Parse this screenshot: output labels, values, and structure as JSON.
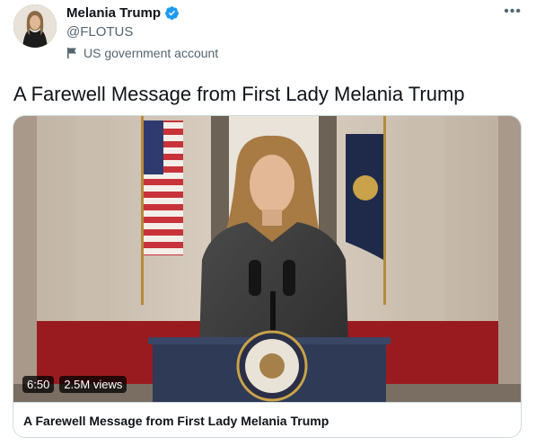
{
  "author": {
    "display_name": "Melania Trump",
    "handle": "@FLOTUS",
    "label": "US government account",
    "verified": true
  },
  "tweet": {
    "text": "A Farewell Message from First Lady Melania Trump"
  },
  "media": {
    "duration": "6:50",
    "views": "2.5M views"
  },
  "card": {
    "title": "A Farewell Message from First Lady Melania Trump"
  },
  "colors": {
    "verified_blue": "#1d9bf0",
    "secondary_text": "#536471",
    "border": "#cfd9de"
  }
}
